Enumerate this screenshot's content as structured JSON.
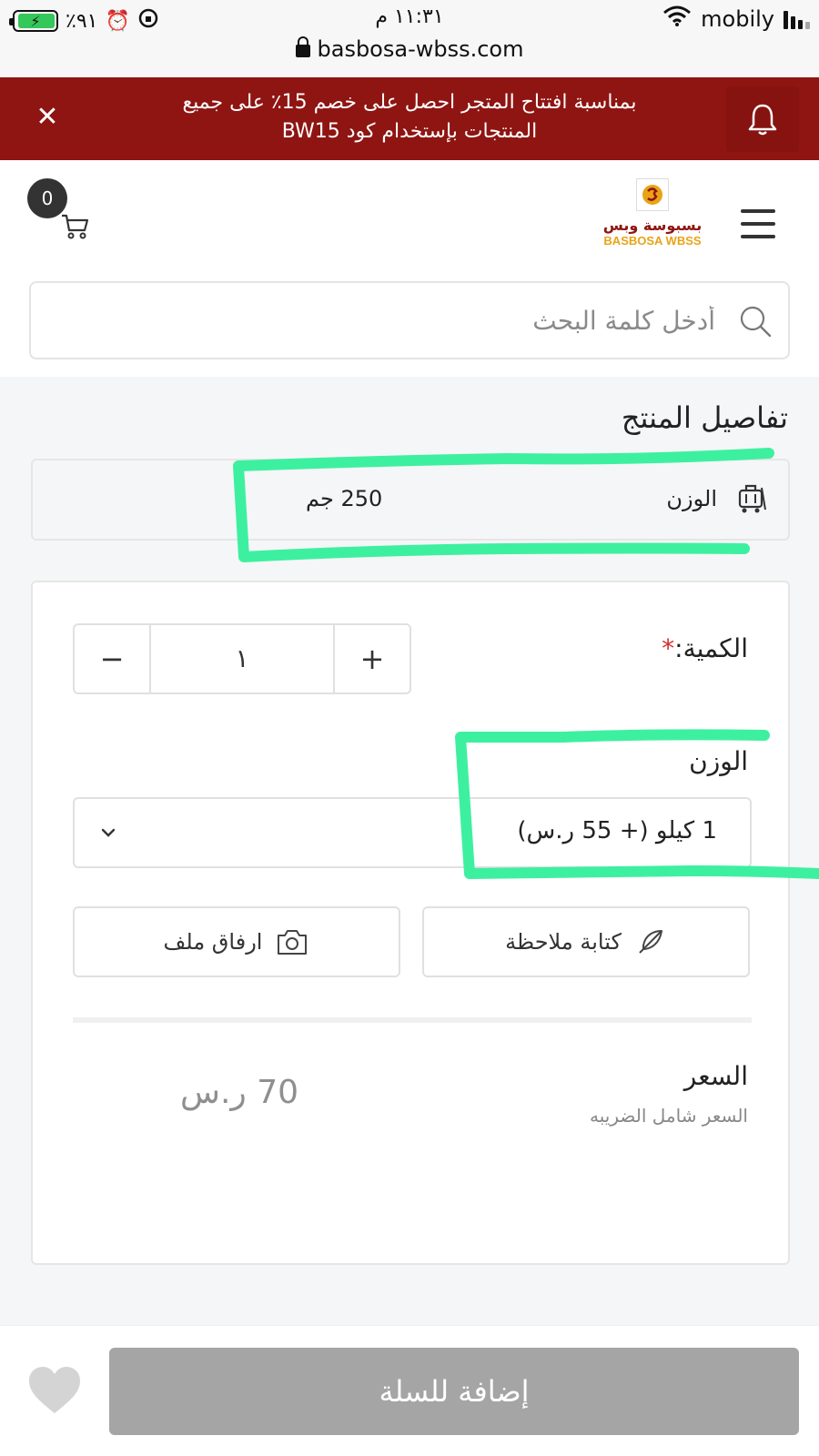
{
  "status_bar": {
    "battery": "٪٩١",
    "time": "١١:٣١ م",
    "carrier": "mobily",
    "url": "basbosa-wbss.com"
  },
  "promo": {
    "line1": "بمناسبة افتتاح المتجر احصل على خصم 15٪ على جميع",
    "line2": "المنتجات بإستخدام كود BW15",
    "close_icon": "close-icon",
    "bell_icon": "bell-icon"
  },
  "header": {
    "cart_count": "0",
    "logo_ar": "بسبوسة وبس",
    "logo_en": "BASBOSA WBSS"
  },
  "search": {
    "placeholder": "أدخل كلمة البحث"
  },
  "product_details": {
    "title": "تفاصيل المنتج",
    "weight_label": "الوزن",
    "weight_value": "250 جم"
  },
  "options": {
    "quantity_label": "الكمية:",
    "required_mark": "*",
    "quantity_value": "١",
    "minus": "−",
    "plus": "+",
    "weight_label": "الوزن",
    "weight_selected": "1 كيلو (+ 55 ر.س)",
    "note_button": "كتابة ملاحظة",
    "attach_button": "ارفاق ملف",
    "price_label": "السعر",
    "price_note": "السعر شامل الضريبه",
    "price_value": "70 ر.س"
  },
  "bottom": {
    "add_to_cart": "إضافة للسلة"
  },
  "colors": {
    "banner": "#8e1512",
    "annotation_green": "#3df0a0",
    "add_to_cart_disabled": "#a5a5a5"
  }
}
